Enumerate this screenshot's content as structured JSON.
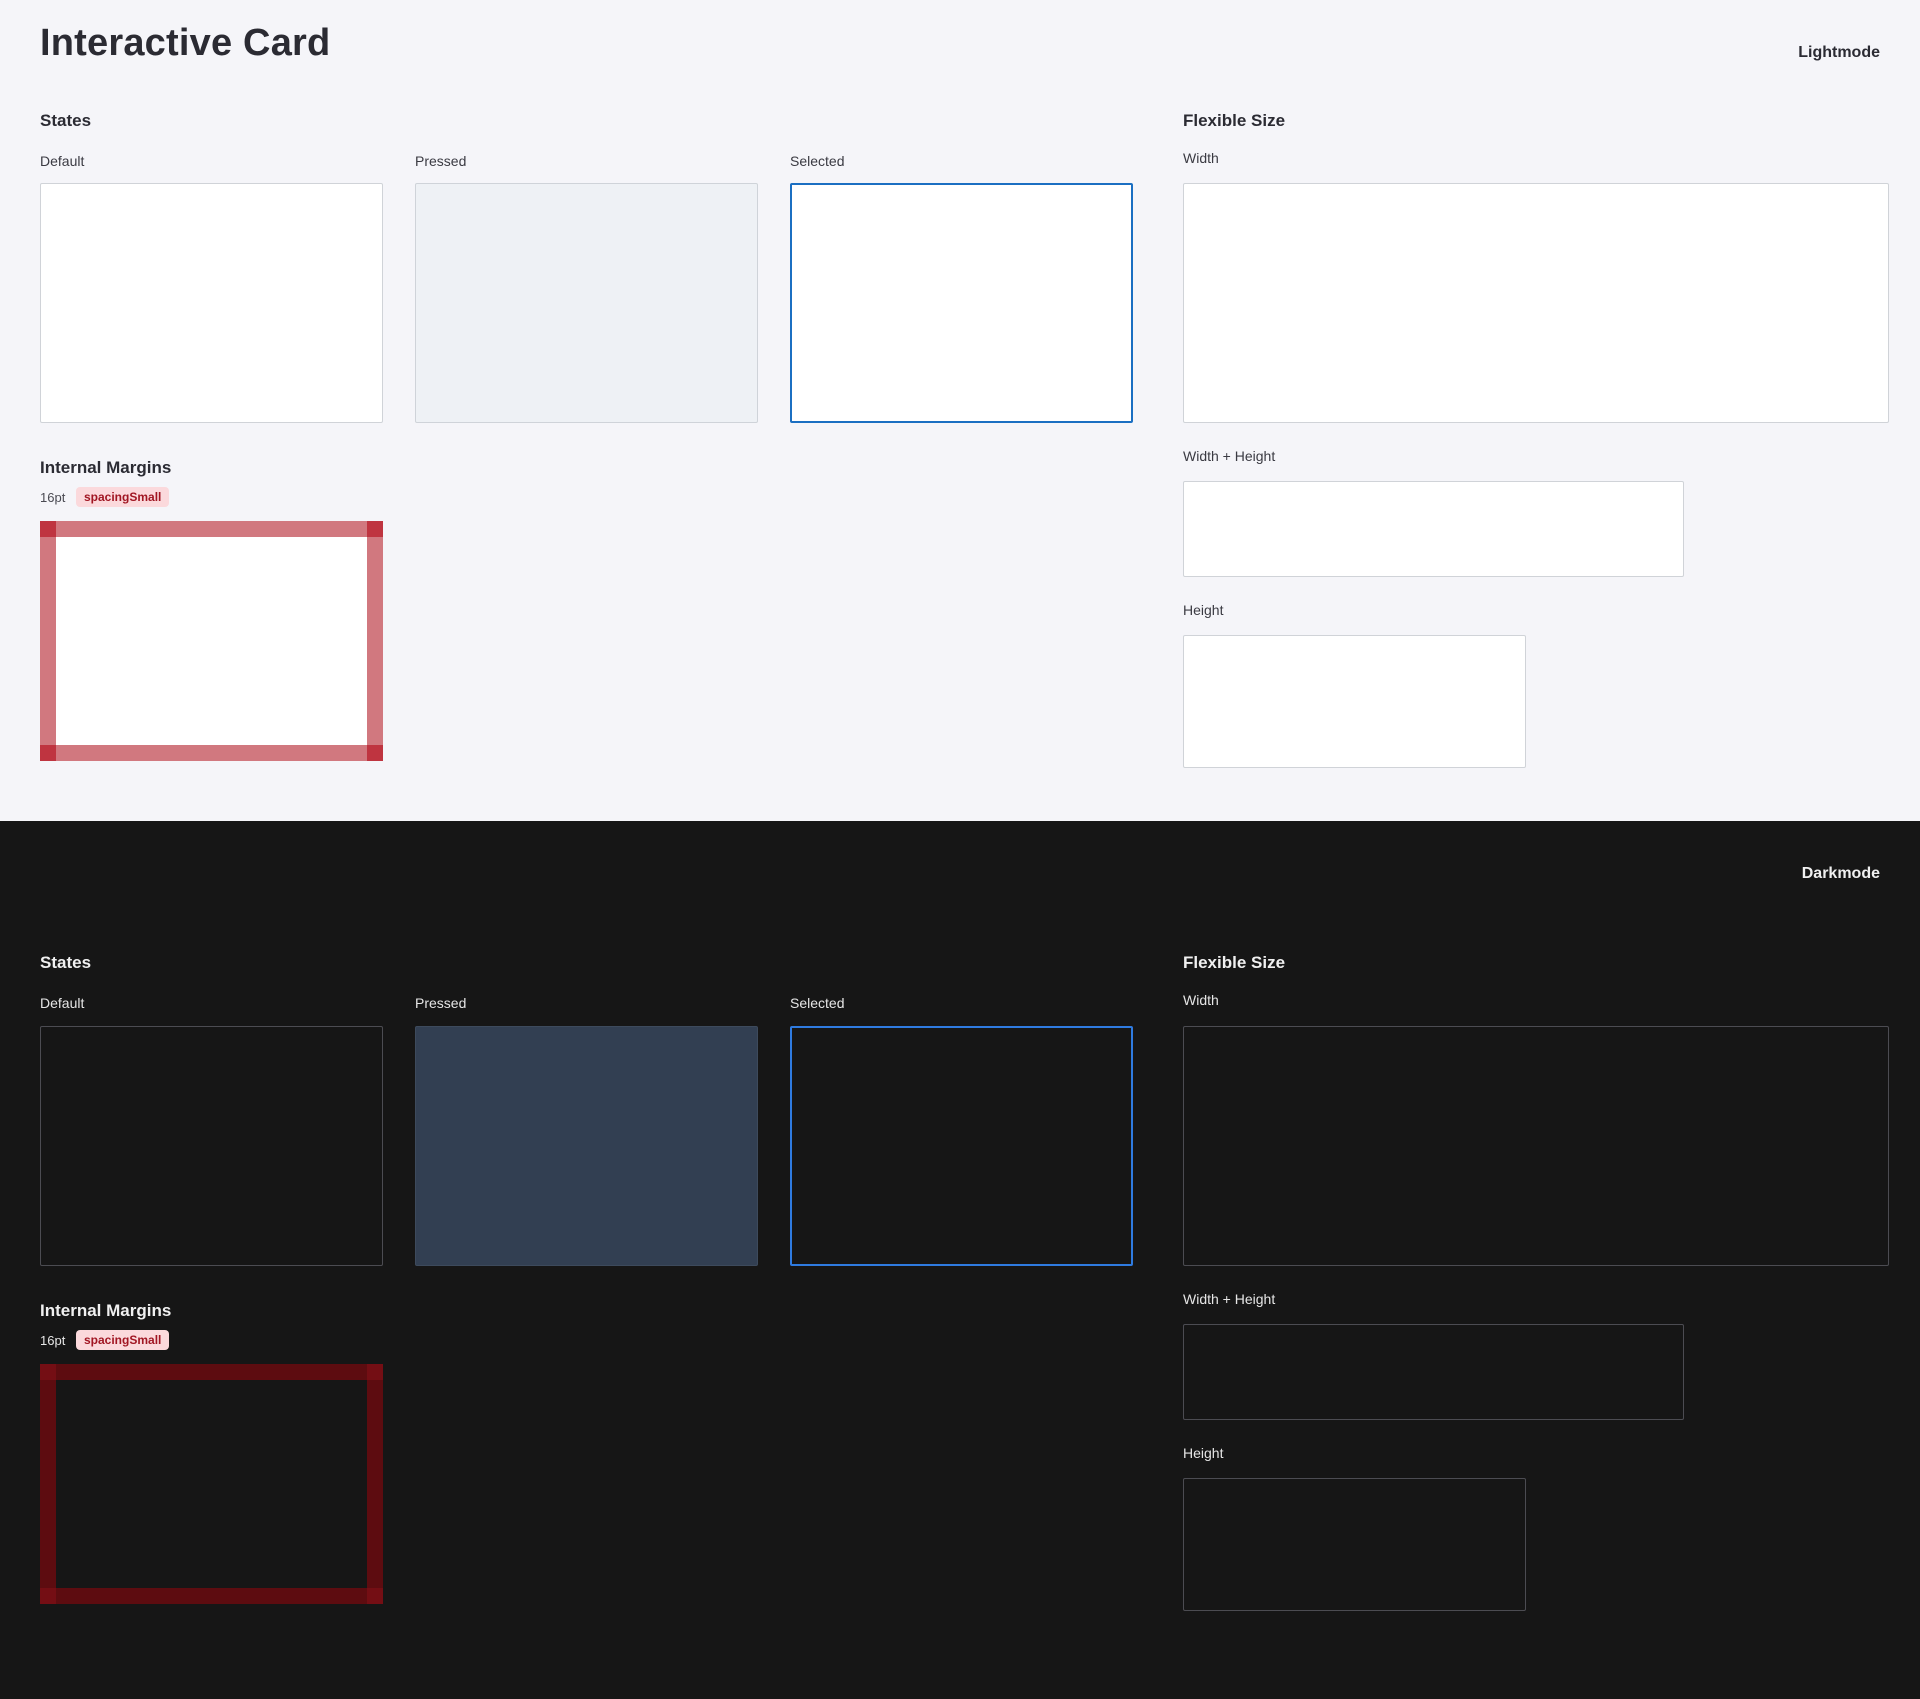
{
  "title": "Interactive Card",
  "light": {
    "mode_label": "Lightmode",
    "states_heading": "States",
    "states": {
      "default": "Default",
      "pressed": "Pressed",
      "selected": "Selected"
    },
    "margins_heading": "Internal Margins",
    "margin_value": "16pt",
    "margin_token": "spacingSmall",
    "flex_heading": "Flexible Size",
    "flex": {
      "width": "Width",
      "width_height": "Width + Height",
      "height": "Height"
    }
  },
  "dark": {
    "mode_label": "Darkmode",
    "states_heading": "States",
    "states": {
      "default": "Default",
      "pressed": "Pressed",
      "selected": "Selected"
    },
    "margins_heading": "Internal Margins",
    "margin_value": "16pt",
    "margin_token": "spacingSmall",
    "flex_heading": "Flexible Size",
    "flex": {
      "width": "Width",
      "width_height": "Width + Height",
      "height": "Height"
    }
  },
  "colors": {
    "light_bg": "#f5f5f9",
    "dark_bg": "#161616",
    "selected_light": "#1b6fc2",
    "selected_dark": "#2f7be0",
    "pressed_light": "#eef1f5",
    "pressed_dark": "#323f52",
    "margin_light": "#d1787f",
    "margin_dark": "#5d0c10",
    "token_badge_bg": "#fbd9dc",
    "token_badge_text": "#a11623"
  }
}
